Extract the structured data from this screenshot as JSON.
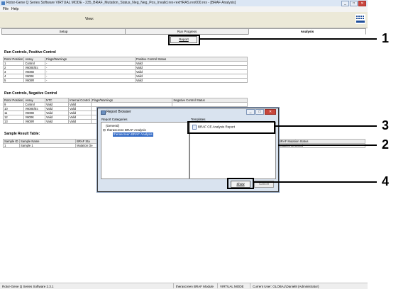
{
  "window": {
    "title": "Rotor-Gene Q Series Software VIRTUAL MODE - 235_BRAF_Mutation_Status_Neg_Neg_Pos_Invalid.rex-rexHRAS.rex000.rex - [BRAF Analysis]",
    "controls": [
      "_",
      "□",
      "✕"
    ]
  },
  "menu": {
    "file": "File",
    "help": "Help"
  },
  "toolbar": {
    "view_label": "View:"
  },
  "tabs": [
    {
      "label": "Setup"
    },
    {
      "label": "Run Progress"
    },
    {
      "label": "Analysis"
    }
  ],
  "report_button": "Report",
  "positive_controls": {
    "title": "Run Controls, Positive Control",
    "columns": [
      "Rotor Position",
      "Assay",
      "Flags/Warnings",
      "Positive Control Status"
    ],
    "rows": [
      [
        "1",
        "Control",
        "-",
        "Valid"
      ],
      [
        "2",
        "V600E/Ec",
        "-",
        "Valid"
      ],
      [
        "3",
        "V600D",
        "-",
        "Valid"
      ],
      [
        "4",
        "V600K",
        "-",
        "Valid"
      ],
      [
        "5",
        "V600R",
        "-",
        "Valid"
      ]
    ]
  },
  "negative_controls": {
    "title": "Run Controls, Negative Control",
    "columns": [
      "Rotor Position",
      "Assay",
      "NTC",
      "Internal Control",
      "Flags/Warnings",
      "Negative Control Status"
    ],
    "rows": [
      [
        "9",
        "Control",
        "Valid",
        "Valid",
        "",
        ""
      ],
      [
        "10",
        "V600E/Ec",
        "Valid",
        "Valid",
        "",
        ""
      ],
      [
        "11",
        "V600D",
        "Valid",
        "Valid",
        "",
        ""
      ],
      [
        "12",
        "V600K",
        "Valid",
        "Valid",
        "",
        ""
      ],
      [
        "13",
        "V600R",
        "Valid",
        "Valid",
        "",
        ""
      ]
    ]
  },
  "sample_results": {
    "title": "Sample Result Table:",
    "columns": [
      "Sample ID",
      "Sample Name",
      "BRAF Sta"
    ],
    "rows": [
      [
        "1",
        "Sample 1",
        "Mutation De"
      ]
    ],
    "right_header": "BRAF Mutation Status",
    "right_value": "Mutation Detected"
  },
  "status_bar": {
    "version": "Rotor-Gene Q Series Software 2.3.1",
    "module": "therascreen BRAF Module",
    "mode": "VIRTUAL MODE",
    "user": "Current User: GLOBAL\\Daniel8 (Administrator)"
  },
  "report_browser": {
    "title": "Report Browser",
    "categories_label": "Report Categories",
    "templates_label": "Templates",
    "tree": {
      "general": "(General)",
      "group": "therascreen BRAF Analysis",
      "selected": "therascreen BRAF Analysis"
    },
    "template_item": "BRAF CE Analysis Report",
    "show_button": "Show",
    "cancel_button": "Cancel"
  },
  "callouts": [
    "1",
    "2",
    "3",
    "4"
  ]
}
